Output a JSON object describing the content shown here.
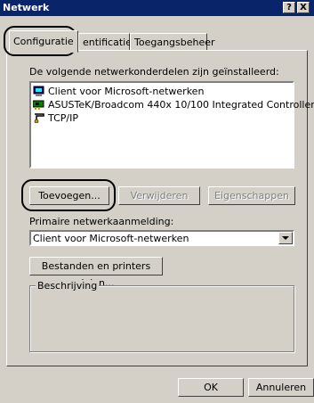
{
  "window": {
    "title": "Netwerk",
    "help_button": "?",
    "close_button": "X"
  },
  "tabs": [
    {
      "label": "Configuratie",
      "active": true
    },
    {
      "label": "Identificatie",
      "visible_label": "entificatie",
      "active": false
    },
    {
      "label": "Toegangsbeheer",
      "active": false
    }
  ],
  "components_label": "De volgende netwerkonderdelen zijn geïnstalleerd:",
  "components": [
    {
      "label": "Client voor Microsoft-netwerken",
      "icon": "client-icon"
    },
    {
      "label": "ASUSTeK/Broadcom 440x 10/100 Integrated Controller",
      "icon": "network-adapter-icon"
    },
    {
      "label": "TCP/IP",
      "icon": "protocol-icon"
    }
  ],
  "buttons": {
    "add": "Toevoegen...",
    "remove": "Verwijderen",
    "properties": "Eigenschappen",
    "file_print_sharing": "Bestanden en printers delen...",
    "ok": "OK",
    "cancel": "Annuleren"
  },
  "primary_logon": {
    "label": "Primaire netwerkaanmelding:",
    "value": "Client voor Microsoft-netwerken"
  },
  "description_group": {
    "label": "Beschrijving"
  },
  "colors": {
    "titlebar": "#0a246a",
    "face": "#d4d0c8",
    "highlight": "#000000"
  }
}
